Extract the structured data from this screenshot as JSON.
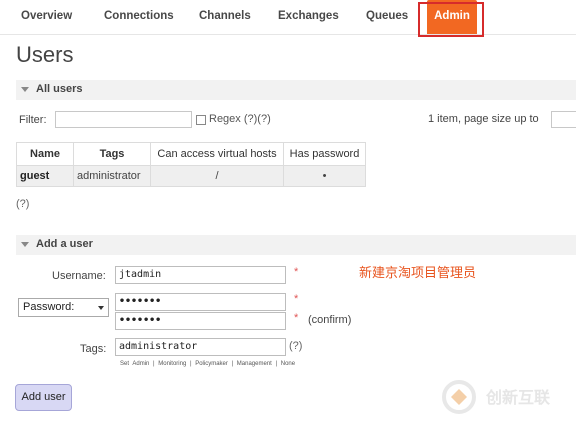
{
  "nav": {
    "tabs": [
      "Overview",
      "Connections",
      "Channels",
      "Exchanges",
      "Queues",
      "Admin"
    ],
    "active": "Admin"
  },
  "page": {
    "title": "Users"
  },
  "all_users": {
    "header": "All users",
    "filter_label": "Filter:",
    "filter_value": "",
    "regex_label": "Regex (?)(?)",
    "pagination": "1 item, page size up to",
    "table": {
      "columns": [
        "Name",
        "Tags",
        "Can access virtual hosts",
        "Has password"
      ],
      "rows": [
        {
          "name": "guest",
          "tags": "administrator",
          "vhosts": "/",
          "has_password": "•"
        }
      ]
    },
    "help": "(?)"
  },
  "add_user": {
    "header": "Add a user",
    "username_label": "Username:",
    "username_value": "jtadmin",
    "password_select": "Password:",
    "password_value": "•••••••",
    "confirm_value": "•••••••",
    "required_mark": "*",
    "confirm_label": "(confirm)",
    "tags_label": "Tags:",
    "tags_value": "administrator",
    "tags_help": "(?)",
    "tag_hints": [
      "Set",
      "Admin",
      "|",
      "Monitoring",
      "|",
      "Policymaker",
      "|",
      "Management",
      "|",
      "None"
    ],
    "button": "Add user"
  },
  "annotation": {
    "text": "新建京淘项目管理员",
    "color": "#e8541e"
  },
  "watermark": {
    "text": "创新互联"
  },
  "colors": {
    "accent": "#f26822",
    "highlight_box": "#d62b2b",
    "button_bg": "#d8d8f4"
  }
}
